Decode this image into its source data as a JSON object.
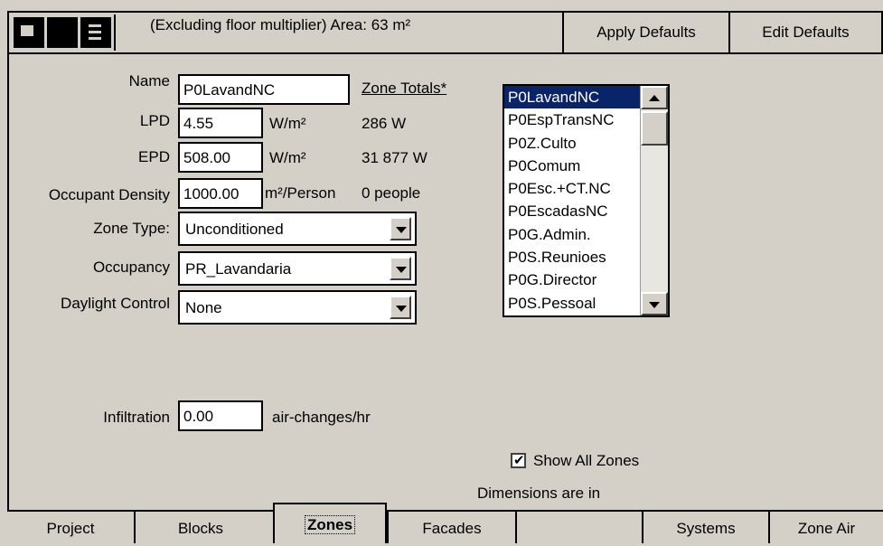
{
  "toolbar": {
    "area_text": "(Excluding floor multiplier) Area: 63 m²",
    "apply_defaults": "Apply Defaults",
    "edit_defaults": "Edit Defaults"
  },
  "form": {
    "name_label": "Name",
    "name_value": "P0LavandNC",
    "zone_totals_label": "Zone Totals*",
    "lpd_label": "LPD",
    "lpd_value": "4.55",
    "lpd_unit": "W/m²",
    "lpd_total": "286 W",
    "epd_label": "EPD",
    "epd_value": "508.00",
    "epd_unit": "W/m²",
    "epd_total": "31 877 W",
    "occ_density_label": "Occupant Density",
    "occ_density_value": "1000.00",
    "occ_density_unit": "m²/Person",
    "occ_total": "0 people",
    "zone_type_label": "Zone Type:",
    "zone_type_value": "Unconditioned",
    "occupancy_label": "Occupancy",
    "occupancy_value": "PR_Lavandaria",
    "daylight_label": "Daylight Control",
    "daylight_value": "None",
    "infiltration_label": "Infiltration",
    "infiltration_value": "0.00",
    "infiltration_unit": "air-changes/hr"
  },
  "zone_list": {
    "items": [
      "P0LavandNC",
      "P0EspTransNC",
      "P0Z.Culto",
      "P0Comum",
      "P0Esc.+CT.NC",
      "P0EscadasNC",
      "P0G.Admin.",
      "P0S.Reunioes",
      "P0G.Director",
      "P0S.Pessoal"
    ],
    "selected_index": 0
  },
  "show_all_zones": {
    "label": "Show All Zones",
    "checked": true
  },
  "dimensions_text": "Dimensions are in",
  "tabs": [
    "Project",
    "Blocks",
    "Zones",
    "Facades",
    "",
    "Systems",
    "Zone Air"
  ],
  "active_tab": "Zones"
}
